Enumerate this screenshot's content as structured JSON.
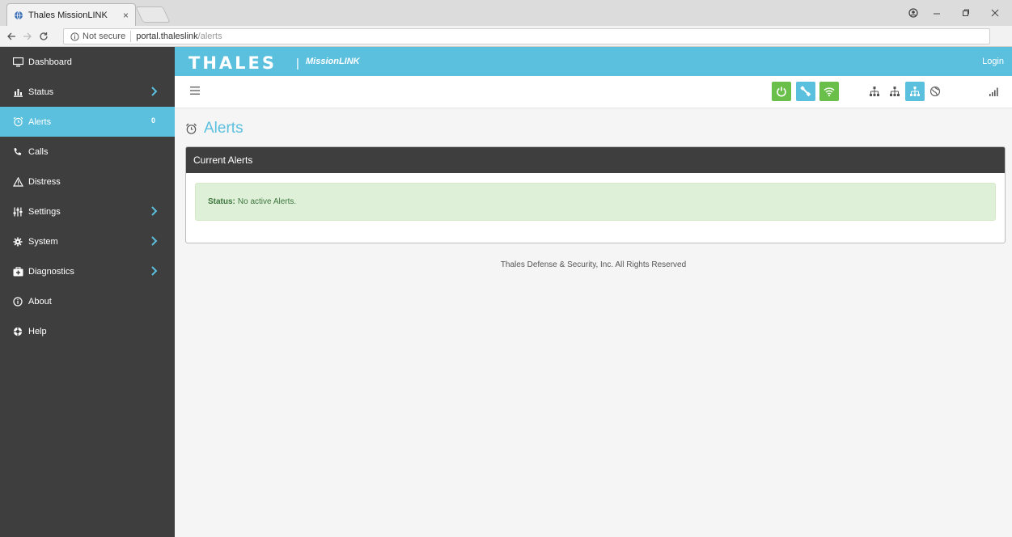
{
  "browser": {
    "tab_title": "Thales MissionLINK",
    "tab_close": "×",
    "security_label": "Not secure",
    "url_host": "portal.thaleslink",
    "url_path": "/alerts"
  },
  "sidebar": {
    "items": [
      {
        "label": "Dashboard",
        "icon": "monitor-icon"
      },
      {
        "label": "Status",
        "icon": "bar-chart-icon",
        "has_children": true
      },
      {
        "label": "Alerts",
        "icon": "alarm-clock-icon",
        "active": true,
        "count": "0"
      },
      {
        "label": "Calls",
        "icon": "phone-icon"
      },
      {
        "label": "Distress",
        "icon": "warning-icon"
      },
      {
        "label": "Settings",
        "icon": "sliders-icon",
        "has_children": true
      },
      {
        "label": "System",
        "icon": "gear-icon",
        "has_children": true
      },
      {
        "label": "Diagnostics",
        "icon": "medkit-icon",
        "has_children": true
      },
      {
        "label": "About",
        "icon": "info-icon"
      },
      {
        "label": "Help",
        "icon": "lifebuoy-icon"
      }
    ]
  },
  "header": {
    "brand": "THALES",
    "separator": "|",
    "product": "MissionLINK",
    "login": "Login"
  },
  "main": {
    "title": "Alerts",
    "panel_title": "Current Alerts",
    "status_label": "Status:",
    "status_text": "No active Alerts."
  },
  "footer": {
    "text": "Thales Defense & Security, Inc. All Rights Reserved"
  },
  "colors": {
    "accent": "#5bc0de",
    "sidebar_bg": "#3e3e3e",
    "success_bg": "#dff0d8",
    "success_text": "#3c763d",
    "green_button": "#6abf4b"
  }
}
